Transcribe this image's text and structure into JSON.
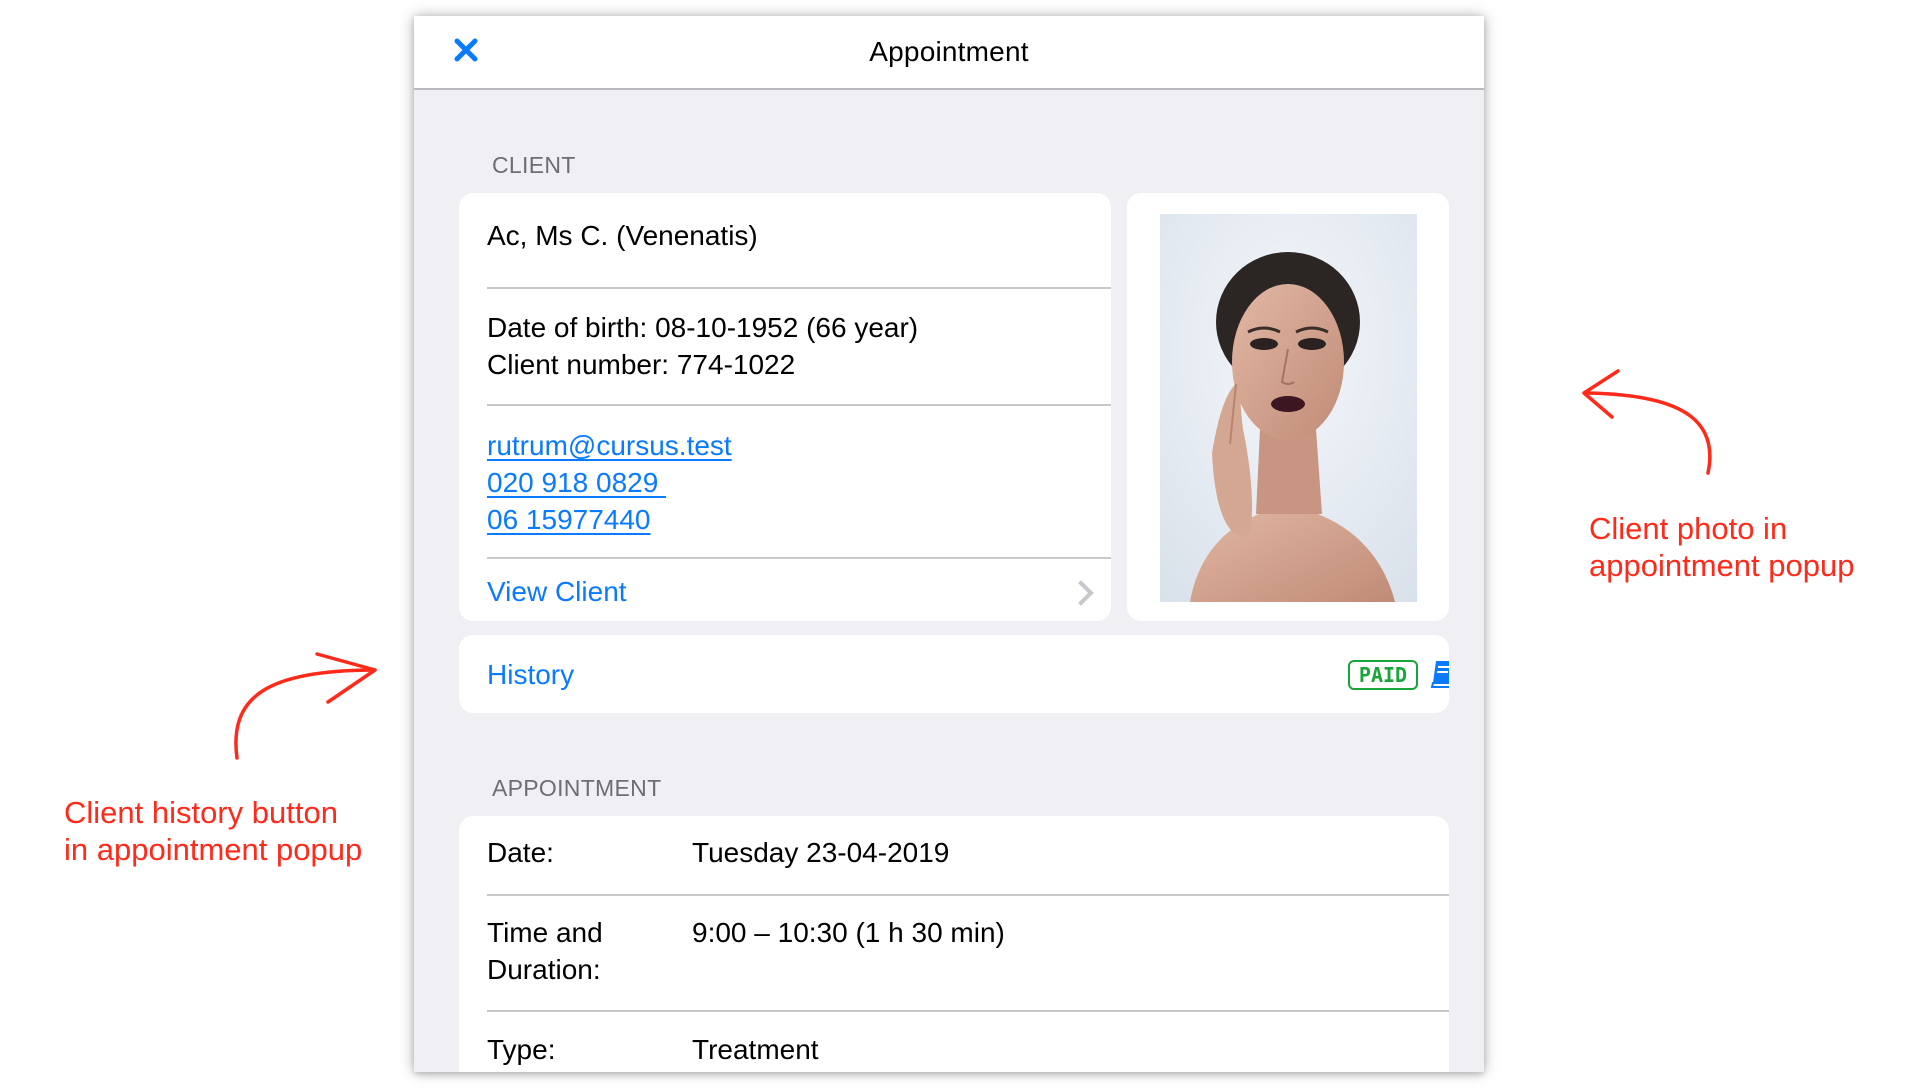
{
  "header": {
    "title": "Appointment",
    "close_icon": "close-icon"
  },
  "client_section": {
    "label": "CLIENT",
    "name": "Ac, Ms C. (Venenatis)",
    "dob": "Date of birth: 08-10-1952 (66 year)",
    "client_number": "Client number: 774-1022",
    "email": "rutrum@cursus.test",
    "phone1": "020 918 0829 ",
    "phone2": "06 15977440",
    "view_client": "View Client"
  },
  "history": {
    "label": "History",
    "badge": "PAID",
    "book_icon": "book-icon"
  },
  "appointment_section": {
    "label": "APPOINTMENT",
    "rows": [
      {
        "label": "Date:",
        "value": "Tuesday 23-04-2019"
      },
      {
        "label_line1": "Time and",
        "label_line2": "Duration:",
        "value": "9:00 – 10:30 (1 h 30 min)"
      },
      {
        "label": "Type:",
        "value": "Treatment"
      }
    ]
  },
  "annotations": {
    "photo_line1": "Client photo in",
    "photo_line2": "appointment popup",
    "history_line1": "Client history button",
    "history_line2": "in appointment popup"
  },
  "colors": {
    "accent": "#0a7aff",
    "annotation": "#ff2a1a",
    "paid": "#1aa53a",
    "background": "#efeff4"
  }
}
